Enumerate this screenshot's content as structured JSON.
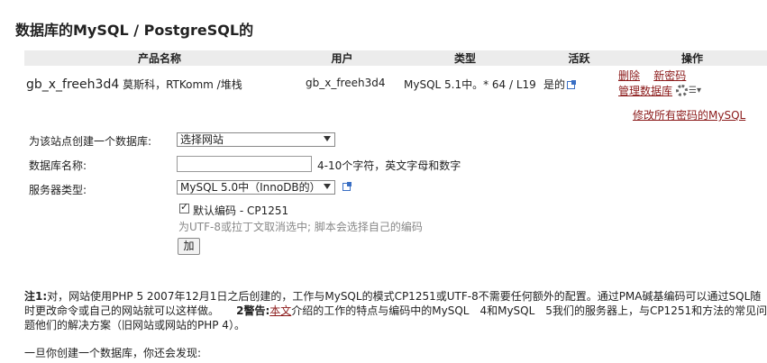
{
  "page": {
    "title": "数据库的MySQL / PostgreSQL的"
  },
  "table": {
    "headers": [
      "产品名称",
      "用户",
      "类型",
      "活跃",
      "操作"
    ],
    "row": {
      "name": "gb_x_freeh3d4",
      "owner": "莫斯科，RTKomm /堆栈",
      "user": "gb_x_freeh3d4",
      "type": "MySQL 5.1中。* 64 / L19",
      "active": "是的"
    },
    "actions": {
      "delete": "删除",
      "new_password": "新密码",
      "manage": "管理数据库",
      "change_all_passwords": "修改所有密码的MySQL"
    }
  },
  "form": {
    "site_label": "为该站点创建一个数据库:",
    "site_select": "选择网站",
    "dbname_label": "数据库名称:",
    "dbname_value": "",
    "dbname_hint": "4-10个字符，英文字母和数字",
    "server_label": "服务器类型:",
    "server_select": "MySQL 5.0中（InnoDB的）",
    "default_encoding": "默认编码 - CP1251",
    "encoding_hint": "为UTF-8或拉丁文取消选中; 脚本会选择自己的编码",
    "add_button": "加"
  },
  "note": {
    "n1_label": "注1:",
    "n1_text": "对，网站使用PHP 5 2007年12月1日之后创建的，工作与MySQL的模式CP1251或UTF-8不需要任何额外的配置。通过PMA碱基编码可以通过SQL随时更改命令或自己的网站就可以这样做。",
    "n2_label": "2警告:",
    "n2_link": "本文",
    "n2_text": "介绍的工作的特点与编码中的MySQL　4和MySQL　5我们的服务器上，与CP1251和方法的常见问题他们的解决方案（旧网站或网站的PHP 4）。"
  },
  "footer_text": "一旦你创建一个数据库，你还会发现:"
}
